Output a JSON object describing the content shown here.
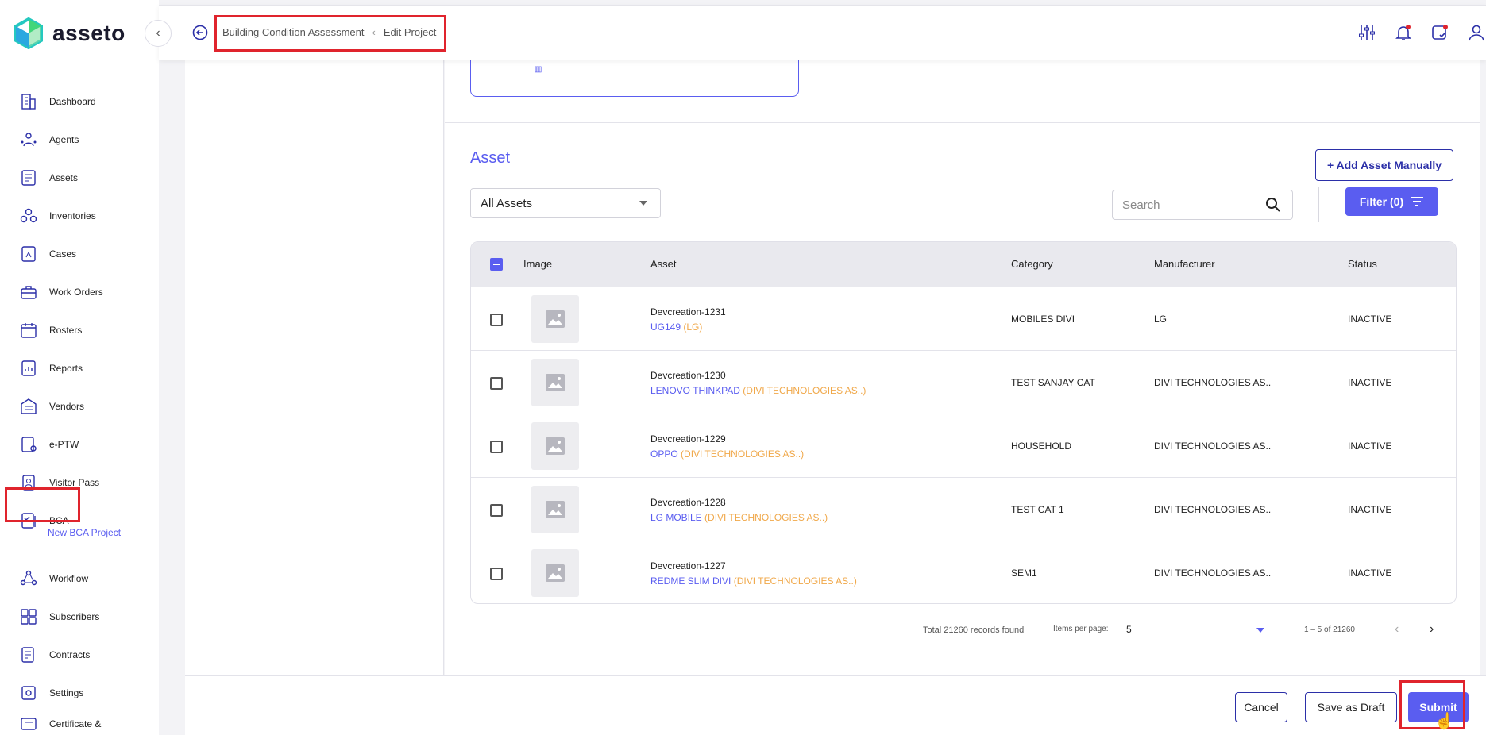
{
  "app": {
    "name": "asseto"
  },
  "sidebar": {
    "items": [
      {
        "label": "Dashboard",
        "icon": "building-icon"
      },
      {
        "label": "Agents",
        "icon": "agents-icon"
      },
      {
        "label": "Assets",
        "icon": "assets-icon"
      },
      {
        "label": "Inventories",
        "icon": "inventories-icon"
      },
      {
        "label": "Cases",
        "icon": "cases-icon"
      },
      {
        "label": "Work Orders",
        "icon": "toolbox-icon"
      },
      {
        "label": "Rosters",
        "icon": "calendar-icon"
      },
      {
        "label": "Reports",
        "icon": "reports-icon"
      },
      {
        "label": "Vendors",
        "icon": "vendors-icon"
      },
      {
        "label": "e-PTW",
        "icon": "permit-icon"
      },
      {
        "label": "Visitor Pass",
        "icon": "badge-icon"
      },
      {
        "label": "BCA",
        "icon": "bca-icon"
      },
      {
        "label": "Workflow",
        "icon": "workflow-icon"
      },
      {
        "label": "Subscribers",
        "icon": "subscribers-icon"
      },
      {
        "label": "Contracts",
        "icon": "contracts-icon"
      },
      {
        "label": "Settings",
        "icon": "settings-icon"
      },
      {
        "label": "Certificate &",
        "icon": "certificate-icon"
      }
    ],
    "sub_item": "New BCA Project"
  },
  "breadcrumb": {
    "parent": "Building Condition Assessment",
    "current": "Edit Project"
  },
  "asset_section": {
    "title": "Asset",
    "add_button": "+ Add Asset Manually",
    "select_value": "All Assets",
    "search_placeholder": "Search",
    "filter_button": "Filter  (0)"
  },
  "table": {
    "headers": {
      "image": "Image",
      "asset": "Asset",
      "category": "Category",
      "manufacturer": "Manufacturer",
      "status": "Status"
    },
    "rows": [
      {
        "name": "Devcreation-1231",
        "model": "UG149",
        "mfr_short": "(LG)",
        "category": "MOBILES DIVI",
        "manufacturer": "LG",
        "status": "INACTIVE"
      },
      {
        "name": "Devcreation-1230",
        "model": "LENOVO THINKPAD",
        "mfr_short": "(DIVI TECHNOLOGIES AS..)",
        "category": "TEST SANJAY CAT",
        "manufacturer": "DIVI TECHNOLOGIES AS..",
        "status": "INACTIVE"
      },
      {
        "name": "Devcreation-1229",
        "model": "OPPO",
        "mfr_short": "(DIVI TECHNOLOGIES AS..)",
        "category": "HOUSEHOLD",
        "manufacturer": "DIVI TECHNOLOGIES AS..",
        "status": "INACTIVE"
      },
      {
        "name": "Devcreation-1228",
        "model": "LG MOBILE",
        "mfr_short": "(DIVI TECHNOLOGIES AS..)",
        "category": "TEST CAT 1",
        "manufacturer": "DIVI TECHNOLOGIES AS..",
        "status": "INACTIVE"
      },
      {
        "name": "Devcreation-1227",
        "model": "REDME SLIM DIVI",
        "mfr_short": "(DIVI TECHNOLOGIES AS..)",
        "category": "SEM1",
        "manufacturer": "DIVI TECHNOLOGIES AS..",
        "status": "INACTIVE"
      }
    ]
  },
  "pager": {
    "total": "Total 21260 records found",
    "items_per_page_label": "Items per page:",
    "items_per_page": "5",
    "range": "1 – 5 of 21260"
  },
  "footer": {
    "cancel": "Cancel",
    "draft": "Save as Draft",
    "submit": "Submit"
  },
  "colors": {
    "accent": "#5a5df0",
    "highlight": "#e0242d",
    "manufacturer": "#f0a84a"
  }
}
